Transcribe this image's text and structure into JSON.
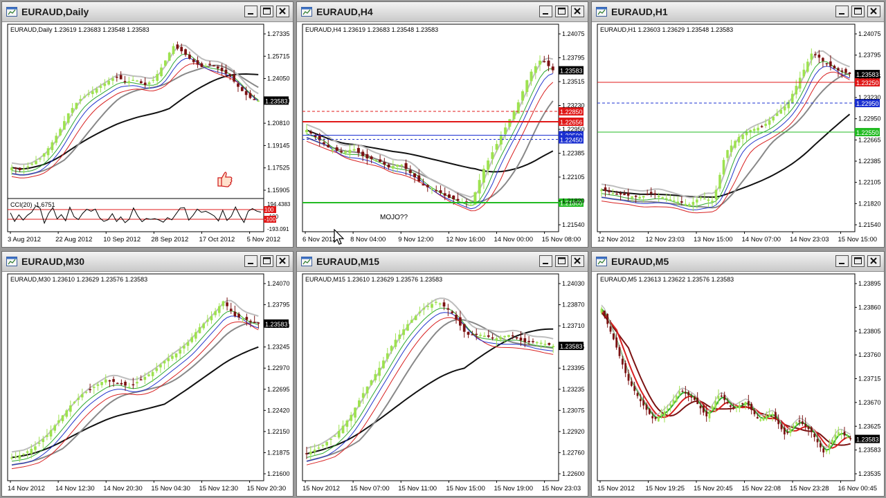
{
  "windows": [
    {
      "id": "daily",
      "title": "EURAUD,Daily",
      "info": "EURAUD,Daily  1.23619 1.23683 1.23548 1.23583",
      "price_ticks": [
        "1.27335",
        "1.25715",
        "1.24050",
        "1.22430",
        "1.20810",
        "1.19145",
        "1.17525",
        "1.15905"
      ],
      "time_labels": [
        "3 Aug 2012",
        "22 Aug 2012",
        "10 Sep 2012",
        "28 Sep 2012",
        "17 Oct 2012",
        "5 Nov 2012"
      ],
      "current_price": "1.23583",
      "indicator": {
        "label": "CCI(20) -1.6751",
        "ticks": [
          "194.4383",
          "-100",
          "-193.091"
        ],
        "levels": [
          "100",
          "-100"
        ]
      }
    },
    {
      "id": "h4",
      "title": "EURAUD,H4",
      "info": "EURAUD,H4  1.23619 1.23683 1.23548 1.23583",
      "price_ticks": [
        "1.24075",
        "1.23795",
        "1.23515",
        "1.23230",
        "1.22950",
        "1.22385",
        "1.22105",
        "1.21820",
        "1.21540"
      ],
      "time_labels": [
        "6 Nov 2012",
        "8 Nov 04:00",
        "9 Nov 12:00",
        "12 Nov 16:00",
        "14 Nov 00:00",
        "15 Nov 08:00"
      ],
      "current_price": "1.23583",
      "level_tags": [
        "1.22850",
        "1.22656",
        "1.22500",
        "1.22450",
        "1.21800"
      ],
      "annotation": "MOJO??"
    },
    {
      "id": "h1",
      "title": "EURAUD,H1",
      "info": "EURAUD,H1  1.23603 1.23629 1.23548 1.23583",
      "price_ticks": [
        "1.24075",
        "1.23795",
        "1.23515",
        "1.23230",
        "1.22950",
        "1.22665",
        "1.22385",
        "1.22105",
        "1.21820",
        "1.21540"
      ],
      "time_labels": [
        "12 Nov 2012",
        "12 Nov 23:03",
        "13 Nov 15:00",
        "14 Nov 07:00",
        "14 Nov 23:03",
        "15 Nov 15:00"
      ],
      "current_price": "1.23583",
      "level_tags": [
        "1.23250",
        "1.22950",
        "1.22550"
      ]
    },
    {
      "id": "m30",
      "title": "EURAUD,M30",
      "info": "EURAUD,M30  1.23610 1.23629 1.23576 1.23583",
      "price_ticks": [
        "1.24070",
        "1.23795",
        "1.23520",
        "1.23245",
        "1.22970",
        "1.22695",
        "1.22420",
        "1.22150",
        "1.21875",
        "1.21600"
      ],
      "time_labels": [
        "14 Nov 2012",
        "14 Nov 12:30",
        "14 Nov 20:30",
        "15 Nov 04:30",
        "15 Nov 12:30",
        "15 Nov 20:30"
      ],
      "current_price": "1.23583"
    },
    {
      "id": "m15",
      "title": "EURAUD,M15",
      "info": "EURAUD,M15  1.23610 1.23629 1.23576 1.23583",
      "price_ticks": [
        "1.24030",
        "1.23870",
        "1.23710",
        "1.23555",
        "1.23395",
        "1.23235",
        "1.23075",
        "1.22920",
        "1.22760",
        "1.22600"
      ],
      "time_labels": [
        "15 Nov 2012",
        "15 Nov 07:00",
        "15 Nov 11:00",
        "15 Nov 15:00",
        "15 Nov 19:00",
        "15 Nov 23:03"
      ],
      "current_price": "1.23583"
    },
    {
      "id": "m5",
      "title": "EURAUD,M5",
      "info": "EURAUD,M5  1.23613 1.23622 1.23576 1.23583",
      "price_ticks": [
        "1.23895",
        "1.23860",
        "1.23805",
        "1.23760",
        "1.23715",
        "1.23670",
        "1.23625",
        "1.23583",
        "1.23535"
      ],
      "time_labels": [
        "15 Nov 2012",
        "15 Nov 19:25",
        "15 Nov 20:45",
        "15 Nov 22:08",
        "15 Nov 23:28",
        "16 Nov 00:45"
      ],
      "current_price": "1.23583"
    }
  ],
  "colors": {
    "bull_candle": "#9de24f",
    "bear_candle": "#7b1212",
    "current_price_tag": "#000000",
    "red_level": "#e01818",
    "blue_level": "#1a2fd0",
    "green_level": "#22bb22",
    "ma_black": "#111111",
    "ma_gray": "#888888",
    "ma_lightgray": "#bdbdbd",
    "ma_green": "#2ea82e",
    "ma_blue": "#2233cc",
    "ma_red": "#d82020"
  },
  "icons": {
    "window": "chart-window-icon",
    "minimize": "minimize-icon",
    "maximize": "maximize-icon",
    "close": "close-icon",
    "cursor": "mouse-pointer-icon",
    "thumbs_up": "thumbs-up-icon"
  }
}
